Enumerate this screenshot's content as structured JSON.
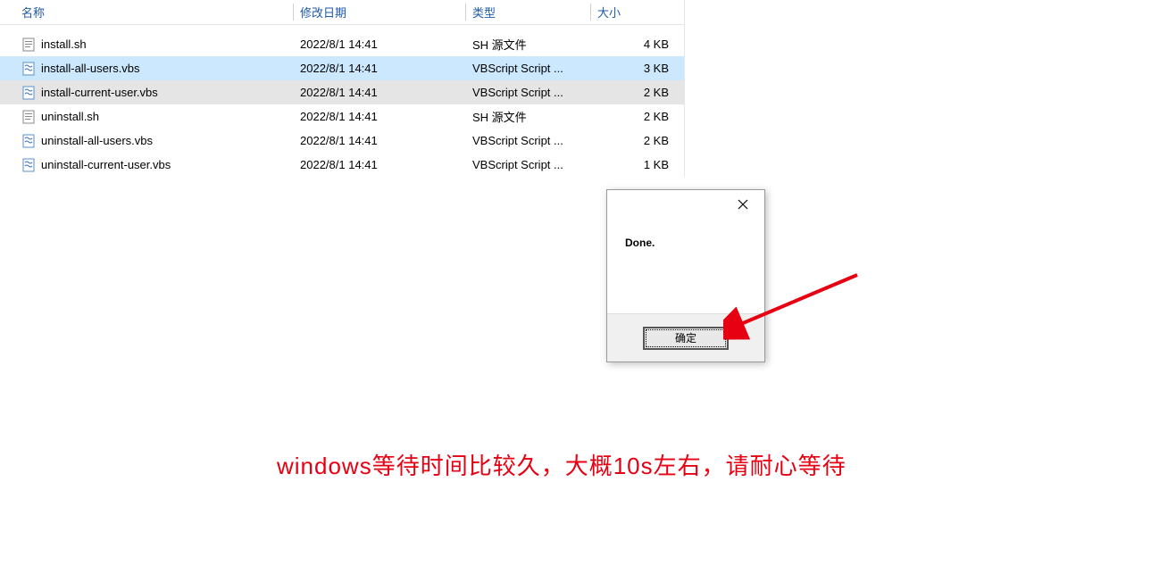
{
  "columns": {
    "name": "名称",
    "date": "修改日期",
    "type": "类型",
    "size": "大小"
  },
  "files": [
    {
      "icon": "sh",
      "name": "install.sh",
      "date": "2022/8/1 14:41",
      "type": "SH 源文件",
      "size": "4 KB",
      "state": ""
    },
    {
      "icon": "vbs",
      "name": "install-all-users.vbs",
      "date": "2022/8/1 14:41",
      "type": "VBScript Script ...",
      "size": "3 KB",
      "state": "selected"
    },
    {
      "icon": "vbs",
      "name": "install-current-user.vbs",
      "date": "2022/8/1 14:41",
      "type": "VBScript Script ...",
      "size": "2 KB",
      "state": "highlighted"
    },
    {
      "icon": "sh",
      "name": "uninstall.sh",
      "date": "2022/8/1 14:41",
      "type": "SH 源文件",
      "size": "2 KB",
      "state": ""
    },
    {
      "icon": "vbs",
      "name": "uninstall-all-users.vbs",
      "date": "2022/8/1 14:41",
      "type": "VBScript Script ...",
      "size": "2 KB",
      "state": ""
    },
    {
      "icon": "vbs",
      "name": "uninstall-current-user.vbs",
      "date": "2022/8/1 14:41",
      "type": "VBScript Script ...",
      "size": "1 KB",
      "state": ""
    }
  ],
  "dialog": {
    "message": "Done.",
    "ok_label": "确定"
  },
  "caption": "windows等待时间比较久，大概10s左右，请耐心等待"
}
